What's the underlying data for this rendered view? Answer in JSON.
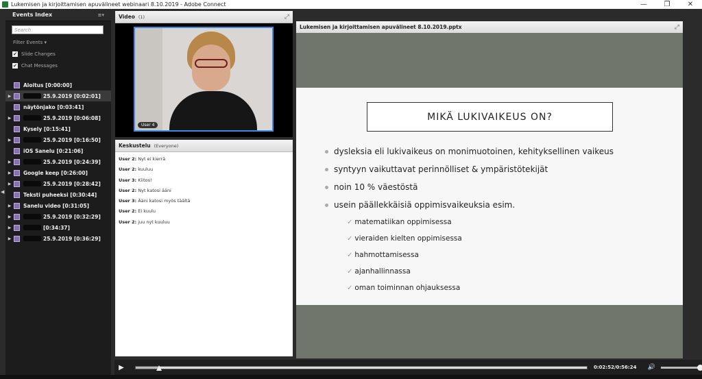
{
  "window": {
    "title": "Lukemisen ja kirjoittamisen apuvälineet webinaari 8.10.2019 - Adobe Connect",
    "min": "—",
    "max": "❐",
    "close": "✕"
  },
  "sidebar": {
    "title": "Events Index",
    "menu_icon": "≡▾",
    "search_placeholder": "Search",
    "filter_label": "Filter Events ▾",
    "checkboxes": [
      {
        "label": "Slide Changes",
        "checked": "✔"
      },
      {
        "label": "Chat Messages",
        "checked": "✔"
      }
    ],
    "events": [
      {
        "text": "Aloitus [0:00:00]",
        "arrow": "",
        "redacted": false
      },
      {
        "text": "25.9.2019 [0:02:01]",
        "arrow": "▶",
        "redacted": true
      },
      {
        "text": "näytönjako [0:03:41]",
        "arrow": "",
        "redacted": false
      },
      {
        "text": "25.9.2019 [0:06:08]",
        "arrow": "▶",
        "redacted": true
      },
      {
        "text": "Kysely [0:15:41]",
        "arrow": "",
        "redacted": false
      },
      {
        "text": "25.9.2019 [0:16:50]",
        "arrow": "▶",
        "redacted": true
      },
      {
        "text": "iOS Sanelu [0:21:06]",
        "arrow": "",
        "redacted": false
      },
      {
        "text": "25.9.2019 [0:24:39]",
        "arrow": "▶",
        "redacted": true
      },
      {
        "text": "Google keep [0:26:00]",
        "arrow": "▶",
        "redacted": false
      },
      {
        "text": "25.9.2019 [0:28:42]",
        "arrow": "▶",
        "redacted": true
      },
      {
        "text": "Teksti puheeksi [0:30:44]",
        "arrow": "",
        "redacted": false
      },
      {
        "text": "Sanelu video [0:31:05]",
        "arrow": "▶",
        "redacted": false
      },
      {
        "text": "25.9.2019 [0:32:29]",
        "arrow": "▶",
        "redacted": true
      },
      {
        "text": "[0:34:37]",
        "arrow": "▶",
        "redacted": true
      },
      {
        "text": "25.9.2019 [0:36:29]",
        "arrow": "▶",
        "redacted": true
      }
    ]
  },
  "video": {
    "title": "Video",
    "count": "(1)",
    "user_tag": "User 4",
    "expand_icon": "⤢"
  },
  "chat": {
    "title": "Keskustelu",
    "scope": "(Everyone)",
    "messages": [
      {
        "user": "User 2:",
        "text": "Nyt ei kierrä"
      },
      {
        "user": "User 2:",
        "text": "kuuluu"
      },
      {
        "user": "User 3:",
        "text": "Kiitos!"
      },
      {
        "user": "User 2:",
        "text": "Nyt katosi ääni"
      },
      {
        "user": "User 3:",
        "text": "Ääni katosi myös täältä"
      },
      {
        "user": "User 2:",
        "text": "Ei kuulu"
      },
      {
        "user": "User 2:",
        "text": "juu nyt kuuluu"
      }
    ]
  },
  "slide": {
    "filename": "Lukemisen ja kirjoittamisen apuvälineet 8.10.2019.pptx",
    "expand_icon": "⤢",
    "title": "MIKÄ LUKIVAIKEUS ON?",
    "bullets": [
      "dysleksia eli lukivaikeus on monimuotoinen, kehityksellinen vaikeus",
      "syntyyn vaikuttavat perinnölliset & ympäristötekijät",
      "noin 10 % väestöstä",
      "usein päällekkäisiä oppimisvaikeuksia esim."
    ],
    "subs": [
      "matematiikan oppimisessa",
      "vieraiden kielten oppimisessa",
      "hahmottamisessa",
      "ajanhallinnassa",
      "oman toiminnan ohjauksessa"
    ],
    "check_glyph": "✓"
  },
  "player": {
    "time": "0:02:52/0:56:24",
    "progress": 0.051,
    "volume": 1.0,
    "play_icon": "▶",
    "volume_icon": "🔊"
  }
}
